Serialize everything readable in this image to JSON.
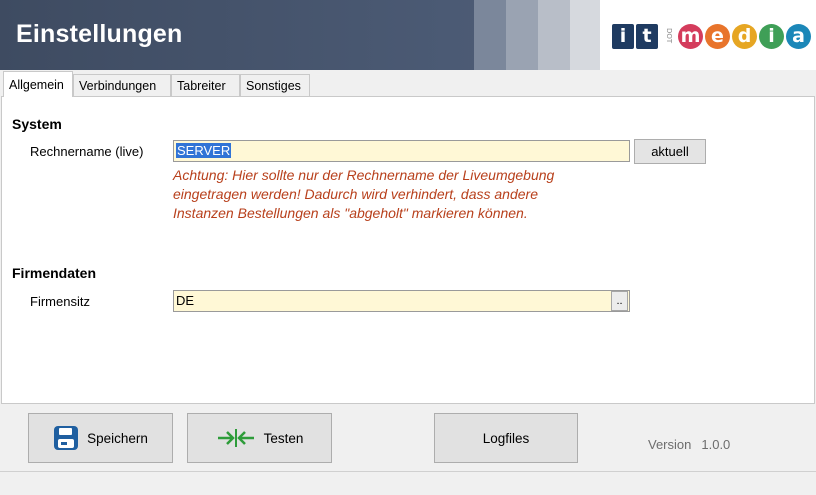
{
  "header": {
    "title": "Einstellungen",
    "logo": {
      "it_letters": [
        "i",
        "t"
      ],
      "dot_text": "DOT",
      "media_letters": [
        "m",
        "e",
        "d",
        "i",
        "a"
      ],
      "media_colors": [
        "#d43c5c",
        "#e8742b",
        "#e6a623",
        "#3f9f57",
        "#1b87b8"
      ],
      "navy": "#1f3b61"
    }
  },
  "tabs": [
    {
      "label": "Allgemein",
      "active": true
    },
    {
      "label": "Verbindungen",
      "active": false
    },
    {
      "label": "Tabreiter",
      "active": false
    },
    {
      "label": "Sonstiges",
      "active": false
    }
  ],
  "system": {
    "heading": "System",
    "computer_name_label": "Rechnername (live)",
    "computer_name_value": "SERVER",
    "current_button": "aktuell",
    "warning_lines": [
      "Achtung: Hier sollte nur der Rechnername der Liveumgebung",
      "eingetragen werden! Dadurch wird verhindert, dass andere",
      "Instanzen Bestellungen als \"abgeholt\" markieren können."
    ]
  },
  "company": {
    "heading": "Firmendaten",
    "headquarters_label": "Firmensitz",
    "headquarters_value": "DE",
    "browse_button": ".."
  },
  "footer": {
    "save_label": "Speichern",
    "test_label": "Testen",
    "logfiles_label": "Logfiles",
    "version_label": "Version",
    "version_value": "1.0.0"
  },
  "colors": {
    "header_bg": "#4b5a74",
    "input_bg": "#fff8d6",
    "warning_text": "#b8401c",
    "selection": "#3174d6",
    "test_icon": "#2e9c3a",
    "save_icon": "#1f5fa0"
  },
  "icons": {
    "save": "floppy-disk-icon",
    "test": "arrows-converge-icon"
  }
}
